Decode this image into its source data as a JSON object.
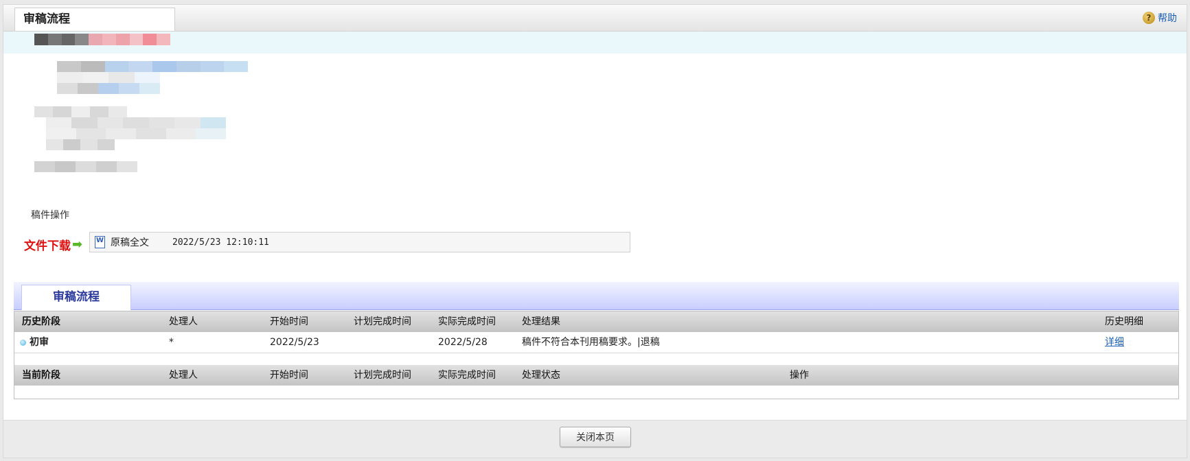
{
  "header": {
    "title": "审稿流程",
    "help_label": "帮助"
  },
  "manuscript": {
    "operation_label": "稿件操作"
  },
  "download": {
    "label": "文件下载",
    "file_name": "原稿全文",
    "file_date": "2022/5/23 12:10:11"
  },
  "workflow": {
    "tab_label": "审稿流程",
    "history_columns": [
      "历史阶段",
      "处理人",
      "开始时间",
      "计划完成时间",
      "实际完成时间",
      "处理结果",
      "历史明细"
    ],
    "history_rows": [
      {
        "stage": "初审",
        "handler": "*",
        "start": "2022/5/23",
        "planned": "",
        "actual": "2022/5/28",
        "result": "稿件不符合本刊用稿要求。|退稿",
        "detail_link": "详细"
      }
    ],
    "current_columns": [
      "当前阶段",
      "处理人",
      "开始时间",
      "计划完成时间",
      "实际完成时间",
      "处理状态",
      "操作"
    ]
  },
  "footer": {
    "close_label": "关闭本页"
  },
  "colors": {
    "accent_blue": "#1a5fb4",
    "download_red": "#e01010",
    "tab_text": "#2b3a9c",
    "info_band": "#eaf8fb"
  }
}
